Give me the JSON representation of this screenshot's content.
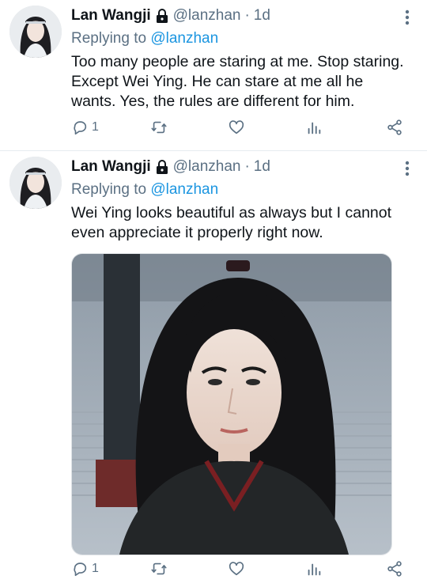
{
  "tweets": [
    {
      "author": {
        "name": "Lan Wangji",
        "handle": "@lanzhan",
        "time": "1d",
        "dot": "·"
      },
      "replying": {
        "prefix": "Replying to ",
        "target": "@lanzhan"
      },
      "text": "Too many people are staring at me. Stop staring. Except Wei Ying. He can stare at me all he wants. Yes, the rules are different for him.",
      "actions": {
        "reply_count": "1"
      }
    },
    {
      "author": {
        "name": "Lan Wangji",
        "handle": "@lanzhan",
        "time": "1d",
        "dot": "·"
      },
      "replying": {
        "prefix": "Replying to ",
        "target": "@lanzhan"
      },
      "text": "Wei Ying looks beautiful as always but I cannot even appreciate it properly right now.",
      "actions": {
        "reply_count": "1"
      }
    }
  ],
  "colors": {
    "link": "#1b95e0",
    "muted": "#5b7083",
    "text": "#0f1419"
  },
  "icons": [
    "lock-icon",
    "more-icon",
    "reply-icon",
    "retweet-icon",
    "like-icon",
    "analytics-icon",
    "share-icon"
  ]
}
